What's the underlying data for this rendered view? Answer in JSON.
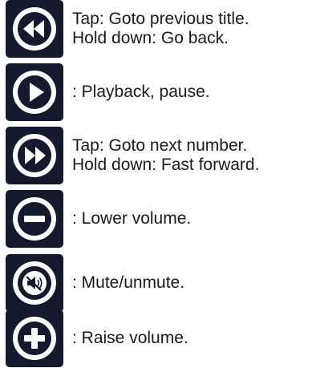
{
  "colors": {
    "tile_background": "#141a2b",
    "icon": "#ffffff",
    "text": "#1a1a1a"
  },
  "controls": [
    {
      "icon": "rewind-icon",
      "lines": [
        "Tap: Goto previous title.",
        "Hold down: Go back."
      ]
    },
    {
      "icon": "play-icon",
      "lines": [
        ": Playback, pause."
      ]
    },
    {
      "icon": "fast-forward-icon",
      "lines": [
        "Tap: Goto next number.",
        "Hold down: Fast forward."
      ]
    },
    {
      "icon": "minus-icon",
      "lines": [
        ": Lower volume."
      ]
    },
    {
      "icon": "mute-icon",
      "lines": [
        ": Mute/unmute."
      ]
    },
    {
      "icon": "plus-icon",
      "lines": [
        ": Raise volume."
      ]
    }
  ]
}
